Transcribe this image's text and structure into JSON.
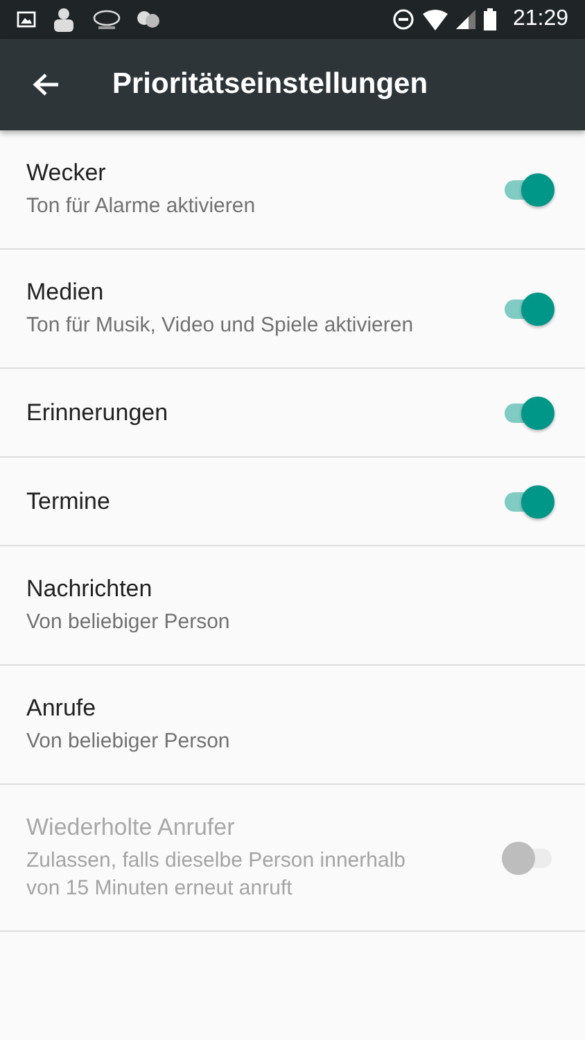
{
  "status_bar": {
    "time": "21:29"
  },
  "toolbar": {
    "title": "Prioritätseinstellungen"
  },
  "items": [
    {
      "kind": "switch",
      "title": "Wecker",
      "subtitle": "Ton für Alarme aktivieren",
      "on": true,
      "disabled": false
    },
    {
      "kind": "switch",
      "title": "Medien",
      "subtitle": "Ton für Musik, Video und Spiele aktivieren",
      "on": true,
      "disabled": false
    },
    {
      "kind": "switch",
      "title": "Erinnerungen",
      "on": true,
      "disabled": false
    },
    {
      "kind": "switch",
      "title": "Termine",
      "on": true,
      "disabled": false
    },
    {
      "kind": "plain",
      "title": "Nachrichten",
      "subtitle": "Von beliebiger Person"
    },
    {
      "kind": "plain",
      "title": "Anrufe",
      "subtitle": "Von beliebiger Person"
    },
    {
      "kind": "switch",
      "title": "Wiederholte Anrufer",
      "subtitle": "Zulassen, falls dieselbe Person innerhalb von 15 Minuten erneut anruft",
      "on": false,
      "disabled": true
    }
  ]
}
